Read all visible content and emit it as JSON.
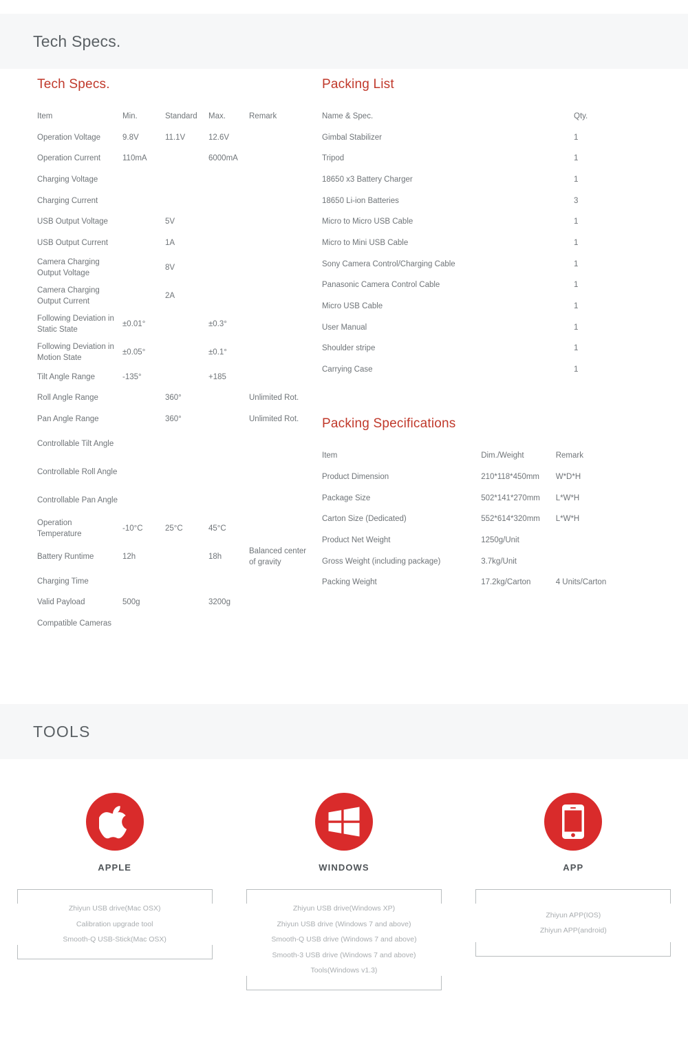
{
  "header": {
    "title": "Tech Specs."
  },
  "tech_specs": {
    "heading": "Tech Specs.",
    "columns": [
      "Item",
      "Min.",
      "Standard",
      "Max.",
      "Remark"
    ],
    "rows": [
      {
        "item": "Operation Voltage",
        "min": "9.8V",
        "std": "11.1V",
        "max": "12.6V",
        "remark": ""
      },
      {
        "item": "Operation Current",
        "min": "110mA",
        "std": "",
        "max": "6000mA",
        "remark": ""
      },
      {
        "item": "Charging Voltage",
        "min": "",
        "std": "",
        "max": "",
        "remark": ""
      },
      {
        "item": "Charging Current",
        "min": "",
        "std": "",
        "max": "",
        "remark": ""
      },
      {
        "item": "USB Output Voltage",
        "min": "",
        "std": "5V",
        "max": "",
        "remark": ""
      },
      {
        "item": "USB Output Current",
        "min": "",
        "std": "1A",
        "max": "",
        "remark": ""
      },
      {
        "item": "Camera Charging Output Voltage",
        "min": "",
        "std": "8V",
        "max": "",
        "remark": ""
      },
      {
        "item": "Camera Charging Output Current",
        "min": "",
        "std": "2A",
        "max": "",
        "remark": ""
      },
      {
        "item": "Following Deviation in Static State",
        "min": "±0.01°",
        "std": "",
        "max": "±0.3°",
        "remark": ""
      },
      {
        "item": "Following Deviation in Motion State",
        "min": "±0.05°",
        "std": "",
        "max": "±0.1°",
        "remark": ""
      },
      {
        "item": "Tilt Angle Range",
        "min": "-135°",
        "std": "",
        "max": "+185",
        "remark": ""
      },
      {
        "item": "Roll Angle Range",
        "min": "",
        "std": "360°",
        "max": "",
        "remark": "Unlimited Rot."
      },
      {
        "item": "Pan Angle Range",
        "min": "",
        "std": "360°",
        "max": "",
        "remark": "Unlimited Rot."
      },
      {
        "item": "Controllable Tilt Angle",
        "min": "",
        "std": "",
        "max": "",
        "remark": ""
      },
      {
        "item": "Controllable Roll Angle",
        "min": "",
        "std": "",
        "max": "",
        "remark": ""
      },
      {
        "item": "Controllable Pan Angle",
        "min": "",
        "std": "",
        "max": "",
        "remark": ""
      },
      {
        "item": "Operation Temperature",
        "min": "-10°C",
        "std": "25°C",
        "max": "45°C",
        "remark": ""
      },
      {
        "item": "Battery Runtime",
        "min": "12h",
        "std": "",
        "max": "18h",
        "remark": "Balanced center of gravity"
      },
      {
        "item": "Charging Time",
        "min": "",
        "std": "",
        "max": "",
        "remark": ""
      },
      {
        "item": "Valid Payload",
        "min": "500g",
        "std": "",
        "max": "3200g",
        "remark": ""
      },
      {
        "item": "Compatible Cameras",
        "min": "",
        "std": "",
        "max": "",
        "remark": ""
      }
    ]
  },
  "packing_list": {
    "heading": "Packing List",
    "columns": [
      "Name & Spec.",
      "Qty."
    ],
    "rows": [
      {
        "name": "Gimbal Stabilizer",
        "qty": "1"
      },
      {
        "name": "Tripod",
        "qty": "1"
      },
      {
        "name": "18650 x3 Battery Charger",
        "qty": "1"
      },
      {
        "name": "18650 Li-ion Batteries",
        "qty": "3"
      },
      {
        "name": "Micro to Micro USB Cable",
        "qty": "1"
      },
      {
        "name": "Micro to Mini USB Cable",
        "qty": "1"
      },
      {
        "name": "Sony Camera Control/Charging Cable",
        "qty": "1"
      },
      {
        "name": "Panasonic Camera Control Cable",
        "qty": "1"
      },
      {
        "name": "Micro USB Cable",
        "qty": "1"
      },
      {
        "name": "User Manual",
        "qty": "1"
      },
      {
        "name": "Shoulder stripe",
        "qty": "1"
      },
      {
        "name": "Carrying Case",
        "qty": "1"
      }
    ]
  },
  "packing_specifications": {
    "heading": "Packing Specifications",
    "columns": [
      "Item",
      "Dim./Weight",
      "Remark"
    ],
    "rows": [
      {
        "item": "Product Dimension",
        "dim": "210*118*450mm",
        "remark": "W*D*H"
      },
      {
        "item": "Package Size",
        "dim": "502*141*270mm",
        "remark": "L*W*H"
      },
      {
        "item": "Carton Size (Dedicated)",
        "dim": "552*614*320mm",
        "remark": "L*W*H"
      },
      {
        "item": "Product Net Weight",
        "dim": "1250g/Unit",
        "remark": ""
      },
      {
        "item": "Gross Weight (including package)",
        "dim": "3.7kg/Unit",
        "remark": ""
      },
      {
        "item": "Packing Weight",
        "dim": "17.2kg/Carton",
        "remark": "4 Units/Carton"
      }
    ]
  },
  "tools": {
    "heading": "TOOLS",
    "cards": [
      {
        "icon": "apple-icon",
        "label": "APPLE",
        "lines": [
          "Zhiyun USB drive(Mac OSX)",
          "Calibration upgrade tool",
          "Smooth-Q USB-Stick(Mac OSX)"
        ]
      },
      {
        "icon": "windows-icon",
        "label": "WINDOWS",
        "lines": [
          "Zhiyun USB drive(Windows XP)",
          "Zhiyun USB drive (Windows 7 and above)",
          "Smooth-Q USB drive (Windows 7 and above)",
          "Smooth-3 USB drive (Windows 7 and above)",
          "Tools(Windows v1.3)"
        ]
      },
      {
        "icon": "smartphone-icon",
        "label": "APP",
        "lines": [
          "Zhiyun APP(IOS)",
          "Zhiyun APP(android)"
        ]
      }
    ]
  },
  "colors": {
    "accent_red": "#c0392b",
    "icon_red": "#d92b2b",
    "banner_bg": "#f6f7f8",
    "body_text": "#6f7478",
    "muted_text": "#a9adb0"
  }
}
